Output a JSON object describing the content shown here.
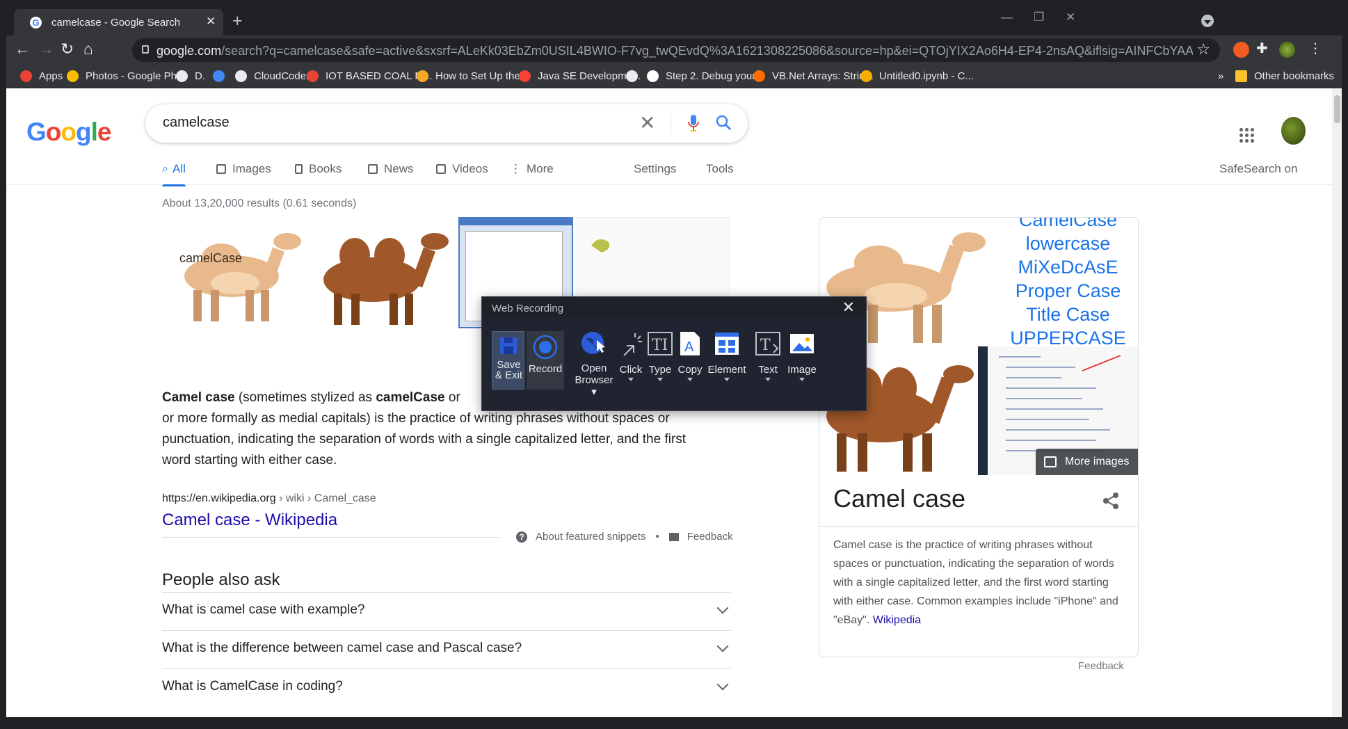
{
  "browser": {
    "tab_title": "camelcase - Google Search",
    "url_domain": "google.com",
    "url_rest": "/search?q=camelcase&safe=active&sxsrf=ALeKk03EbZm0USIL4BWIO-F7vg_twQEvdQ%3A1621308225086&source=hp&ei=QTOjYIX2Ao6H4-EP4-2nsAQ&iflsig=AINFCbYAAAAAY...",
    "bookmarks": [
      {
        "label": "Apps",
        "icon": "apps-grid-icon",
        "color": "#ea4335"
      },
      {
        "label": "Photos - Google Ph...",
        "icon": "google-photos-icon",
        "color": "#fbbc05"
      },
      {
        "label": "D.",
        "icon": "globe-icon",
        "color": "#e8eaed"
      },
      {
        "label": "",
        "icon": "google-icon",
        "color": "#4285f4"
      },
      {
        "label": "CloudCoder",
        "icon": "globe-icon",
        "color": "#e8eaed"
      },
      {
        "label": "IOT BASED COAL M...",
        "icon": "gmail-icon",
        "color": "#ea4335"
      },
      {
        "label": "How to Set Up the...",
        "icon": "site-icon",
        "color": "#f9a825"
      },
      {
        "label": "Java SE Developme...",
        "icon": "oracle-icon",
        "color": "#f44336"
      },
      {
        "label": "",
        "icon": "globe-icon",
        "color": "#e8eaed"
      },
      {
        "label": "Step 2. Debug your...",
        "icon": "jetbrains-icon",
        "color": "#ffffff"
      },
      {
        "label": "VB.Net Arrays: Strin...",
        "icon": "guru99-icon",
        "color": "#ff6d00"
      },
      {
        "label": "Untitled0.ipynb - C...",
        "icon": "colab-icon",
        "color": "#f9ab00"
      }
    ],
    "bookmarks_overflow": "»",
    "other_bookmarks": "Other bookmarks"
  },
  "search": {
    "logo": "Google",
    "query": "camelcase",
    "tabs": [
      {
        "label": "All",
        "active": true
      },
      {
        "label": "Images",
        "active": false
      },
      {
        "label": "Books",
        "active": false
      },
      {
        "label": "News",
        "active": false
      },
      {
        "label": "Videos",
        "active": false
      },
      {
        "label": "More",
        "active": false
      }
    ],
    "settings": "Settings",
    "tools": "Tools",
    "safesearch": "SafeSearch on",
    "stats": "About 13,20,000 results (0.61 seconds)"
  },
  "snippet": {
    "bold1": "Camel case",
    "text1": " (sometimes stylized as ",
    "bold2": "camelCase",
    "text2": " or",
    "line2": "or more formally as medial capitals) is the practice of writing phrases without spaces or",
    "line3": "punctuation, indicating the separation of words with a single capitalized letter, and the first",
    "line4": "word starting with either case.",
    "cite_host": "https://en.wikipedia.org",
    "cite_path": " › wiki › Camel_case",
    "link": "Camel case - Wikipedia",
    "about": "About featured snippets",
    "dot": "•",
    "feedback": "Feedback"
  },
  "camel_label": "camelCase",
  "paa": {
    "title": "People also ask",
    "questions": [
      "What is camel case with example?",
      "What is the difference between camel case and Pascal case?",
      "What is CamelCase in coding?"
    ]
  },
  "knowledge_panel": {
    "case_examples": [
      "CamelCase",
      "lowercase",
      "MiXeDcAsE",
      "Proper Case",
      "Title Case",
      "UPPERCASE"
    ],
    "more_images": "More images",
    "title": "Camel case",
    "description": "Camel case is the practice of writing phrases without spaces or punctuation, indicating the separation of words with a single capitalized letter, and the first word starting with either case. Common examples include \"iPhone\" and \"eBay\". ",
    "source": "Wikipedia",
    "feedback": "Feedback"
  },
  "web_recording": {
    "title": "Web Recording",
    "buttons": [
      {
        "label": "Save\n& Exit",
        "icon": "save-exit-icon"
      },
      {
        "label": "Record",
        "icon": "record-icon"
      },
      {
        "label": "Open\nBrowser",
        "icon": "open-browser-icon"
      },
      {
        "label": "Click",
        "icon": "click-icon"
      },
      {
        "label": "Type",
        "icon": "type-icon"
      },
      {
        "label": "Copy",
        "icon": "copy-icon"
      },
      {
        "label": "Element",
        "icon": "element-icon"
      },
      {
        "label": "Text",
        "icon": "text-icon"
      },
      {
        "label": "Image",
        "icon": "image-icon"
      }
    ]
  }
}
